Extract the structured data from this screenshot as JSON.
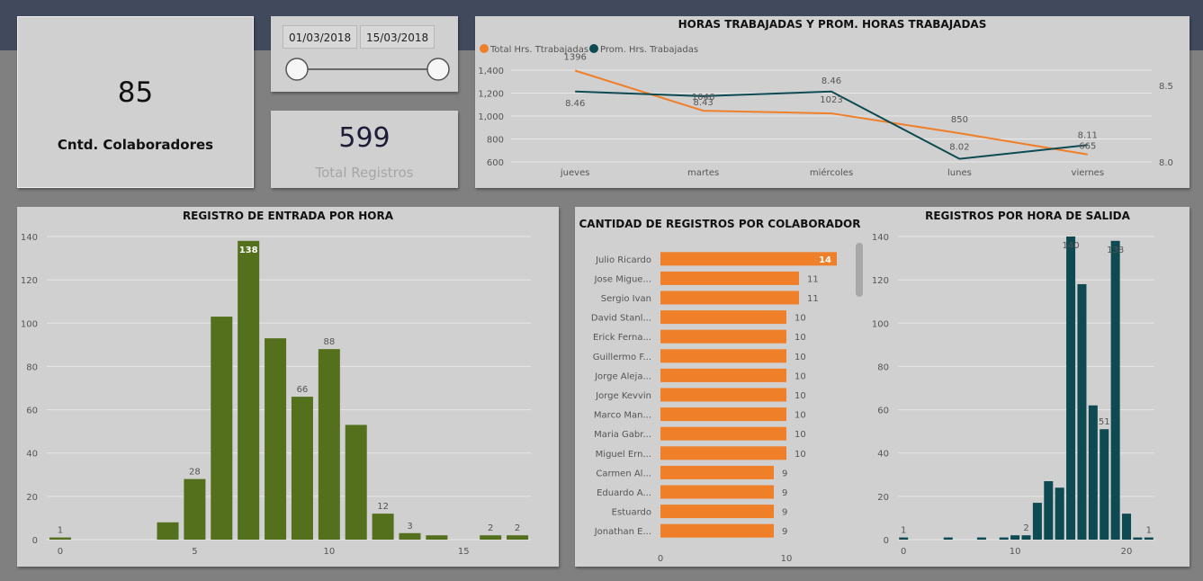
{
  "kpi_colaboradores": {
    "value": "85",
    "label": "Cntd. Colaboradores"
  },
  "date_slicer": {
    "start": "01/03/2018",
    "end": "15/03/2018"
  },
  "kpi_registros": {
    "value": "599",
    "label": "Total Registros"
  },
  "colors": {
    "orange": "#f07f2a",
    "teal": "#0d4a52",
    "green": "#54701c"
  },
  "chart_data": [
    {
      "id": "line",
      "type": "line",
      "title": "HORAS TRABAJADAS Y PROM. HORAS TRABAJADAS",
      "categories": [
        "jueves",
        "martes",
        "miércoles",
        "lunes",
        "viernes"
      ],
      "series": [
        {
          "name": "Total Hrs. Ttrabajadas",
          "values": [
            1396,
            1046,
            1023,
            850,
            665
          ],
          "labels": [
            "1396",
            "1046",
            "1023",
            "850",
            "665"
          ],
          "axis": "left",
          "color": "#f07f2a"
        },
        {
          "name": "Prom. Hrs. Trabajadas",
          "values": [
            8.46,
            8.43,
            8.46,
            8.02,
            8.11
          ],
          "labels": [
            "8.46",
            "8.43",
            "8.46",
            "8.02",
            "8.11"
          ],
          "axis": "right",
          "color": "#0d4a52"
        }
      ],
      "ylim": [
        600,
        1400
      ],
      "yticks": [
        "600",
        "800",
        "1,000",
        "1,200",
        "1,400"
      ],
      "y2lim": [
        8.0,
        8.5
      ],
      "y2ticks": [
        "8.0",
        "8.5"
      ],
      "grid": true,
      "legend": "top-left"
    },
    {
      "id": "entry",
      "type": "bar",
      "title": "REGISTRO DE ENTRADA POR HORA",
      "x": [
        0,
        4,
        5,
        6,
        7,
        8,
        9,
        10,
        11,
        12,
        13,
        14,
        16,
        17
      ],
      "values": [
        1,
        8,
        28,
        103,
        138,
        93,
        66,
        88,
        53,
        12,
        3,
        2,
        2,
        2
      ],
      "labels": [
        "1",
        "",
        "28",
        "",
        "138",
        "",
        "66",
        "88",
        "",
        "12",
        "3",
        "",
        "2",
        "2"
      ],
      "xticks": [
        "0",
        "5",
        "10",
        "15"
      ],
      "xlim": [
        -0.5,
        17.5
      ],
      "ylim": [
        0,
        140
      ],
      "yticks": [
        "0",
        "20",
        "40",
        "60",
        "80",
        "100",
        "120",
        "140"
      ],
      "color": "#54701c",
      "grid": true
    },
    {
      "id": "colab",
      "type": "bar",
      "orientation": "horizontal",
      "title": "CANTIDAD DE REGISTROS POR COLABORADOR",
      "categories": [
        "Julio Ricardo",
        "Jose Migue...",
        "Sergio Ivan",
        "David Stanl...",
        "Erick Ferna...",
        "Guillermo F...",
        "Jorge Aleja...",
        "Jorge Kevvin",
        "Marco Man...",
        "Maria Gabr...",
        "Miguel Ern...",
        "Carmen Al...",
        "Eduardo A...",
        "Estuardo",
        "Jonathan E..."
      ],
      "values": [
        14,
        11,
        11,
        10,
        10,
        10,
        10,
        10,
        10,
        10,
        10,
        9,
        9,
        9,
        9
      ],
      "labels": [
        "14",
        "11",
        "11",
        "10",
        "10",
        "10",
        "10",
        "10",
        "10",
        "10",
        "10",
        "9",
        "9",
        "9",
        "9"
      ],
      "xlim": [
        0,
        14
      ],
      "xticks": [
        "0",
        "10"
      ],
      "color": "#f07f2a"
    },
    {
      "id": "exit",
      "type": "bar",
      "title": "REGISTROS POR HORA DE SALIDA",
      "x": [
        0,
        4,
        7,
        9,
        10,
        11,
        12,
        13,
        14,
        15,
        16,
        17,
        18,
        19,
        20,
        21,
        22
      ],
      "values": [
        1,
        1,
        1,
        1,
        2,
        2,
        17,
        27,
        24,
        140,
        118,
        62,
        51,
        138,
        12,
        1,
        1
      ],
      "labels": [
        "1",
        "",
        "",
        "",
        "",
        "2",
        "",
        "",
        "",
        "140",
        "",
        "",
        "51",
        "138",
        "",
        "",
        "1"
      ],
      "xticks": [
        "0",
        "10",
        "20"
      ],
      "xlim": [
        -0.5,
        22.5
      ],
      "ylim": [
        0,
        140
      ],
      "yticks": [
        "0",
        "20",
        "40",
        "60",
        "80",
        "100",
        "120",
        "140"
      ],
      "color": "#0d4a52",
      "grid": true
    }
  ]
}
